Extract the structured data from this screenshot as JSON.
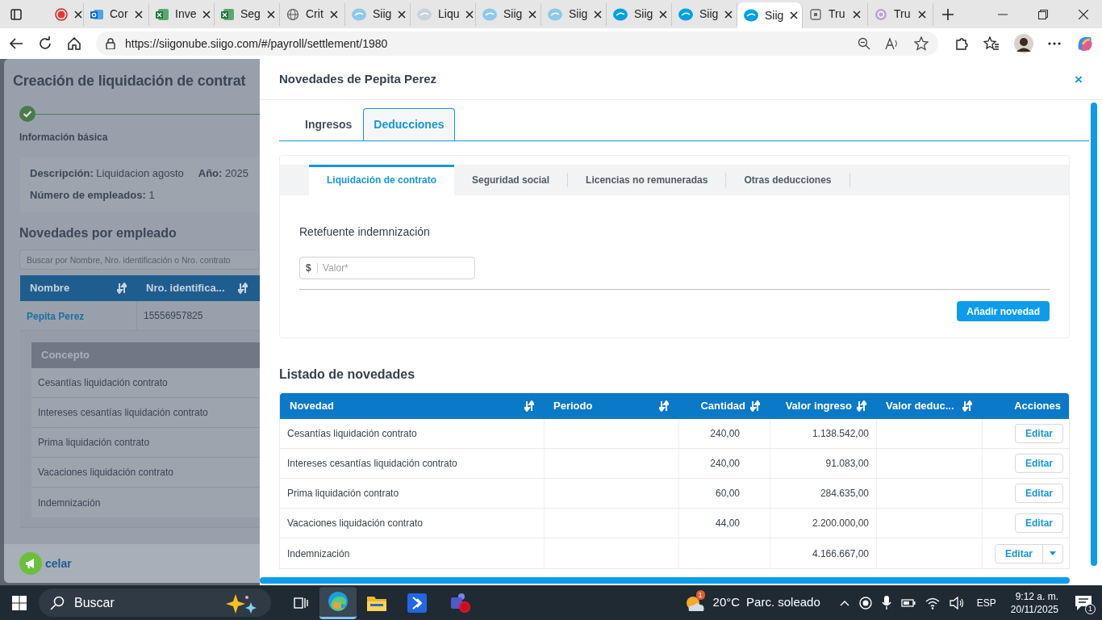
{
  "browser": {
    "tabs": [
      {
        "kind": "record",
        "selected": false
      },
      {
        "kind": "outlook",
        "label": "Cor",
        "selected": false
      },
      {
        "kind": "sheet",
        "label": "Inve",
        "selected": false
      },
      {
        "kind": "sheet",
        "label": "Seg",
        "selected": false
      },
      {
        "kind": "globe",
        "label": "Crit",
        "selected": false
      },
      {
        "kind": "siigo-light",
        "label": "Siig",
        "selected": false
      },
      {
        "kind": "siigo-pale",
        "label": "Liqu",
        "selected": false
      },
      {
        "kind": "siigo-light",
        "label": "Siig",
        "selected": false
      },
      {
        "kind": "siigo-light",
        "label": "Siig",
        "selected": false
      },
      {
        "kind": "siigo",
        "label": "Siig",
        "selected": false
      },
      {
        "kind": "siigo",
        "label": "Siig",
        "selected": false
      },
      {
        "kind": "siigo",
        "label": "Siig",
        "selected": true
      },
      {
        "kind": "page",
        "label": "Tru",
        "selected": false
      },
      {
        "kind": "ring",
        "label": "Tru",
        "selected": false
      }
    ],
    "url": "https://siigonube.siigo.com/#/payroll/settlement/1980"
  },
  "background_page": {
    "title": "Creación de liquidación de contrat",
    "step": "Información básica",
    "info": [
      "**Descripción:** Liquidacion agosto",
      "**Año:** 2025",
      "**Número de empleados:** 1"
    ],
    "section_title": "Novedades por empleado",
    "search": {
      "placeholder": "Buscar por Nombre, Nro. identificación o Nro. contrato"
    },
    "columns": [
      "Nombre",
      "Nro. identifica..."
    ],
    "employee": {
      "name": "Pepita Perez",
      "id": "15556957825"
    },
    "concept_header": "Concepto",
    "concepts": [
      "Cesantías liquidación contrato",
      "Intereses cesantías liquidación contrato",
      "Prima liquidación contrato",
      "Vacaciones liquidación contrato",
      "Indemnización"
    ],
    "cancel": "celar"
  },
  "drawer": {
    "title": "Novedades de Pepita Perez",
    "close": "×",
    "tabs": [
      {
        "label": "Ingresos",
        "selected": false
      },
      {
        "label": "Deducciones",
        "selected": true
      }
    ],
    "subtabs": [
      {
        "label": "Liquidación de contrato",
        "selected": true
      },
      {
        "label": "Seguridad social",
        "selected": false
      },
      {
        "label": "Licencias no remuneradas",
        "selected": false
      },
      {
        "label": "Otras deducciones",
        "selected": false
      }
    ],
    "field": {
      "label": "Retefuente indemnización",
      "prefix": "$",
      "placeholder": "Valor*"
    },
    "add_button": "Añadir novedad",
    "list_title": "Listado de novedades",
    "table": {
      "columns": [
        {
          "label": "Novedad",
          "sortable": true
        },
        {
          "label": "Periodo",
          "sortable": true
        },
        {
          "label": "Cantidad",
          "sortable": true
        },
        {
          "label": "Valor ingreso",
          "sortable": true
        },
        {
          "label": "Valor deduc...",
          "sortable": true
        },
        {
          "label": "Acciones",
          "sortable": false
        }
      ],
      "rows": [
        {
          "novedad": "Cesantías liquidación contrato",
          "cantidad": "240,00",
          "valor_ingreso": "1.138.542,00",
          "action": "Editar",
          "kind": "single"
        },
        {
          "novedad": "Intereses cesantías liquidación contrato",
          "cantidad": "240,00",
          "valor_ingreso": "91.083,00",
          "action": "Editar",
          "kind": "single"
        },
        {
          "novedad": "Prima liquidación contrato",
          "cantidad": "60,00",
          "valor_ingreso": "284.635,00",
          "action": "Editar",
          "kind": "single"
        },
        {
          "novedad": "Vacaciones liquidación contrato",
          "cantidad": "44,00",
          "valor_ingreso": "2.200.000,00",
          "action": "Editar",
          "kind": "single"
        },
        {
          "novedad": "Indemnización",
          "valor_ingreso": "4.166.667,00",
          "action": "Editar",
          "kind": "split"
        }
      ]
    }
  },
  "taskbar": {
    "search": "Buscar",
    "weather": {
      "temp": "20°C",
      "text": "Parc. soleado",
      "badge": "1"
    },
    "language": "ESP",
    "time": "9:12 a. m.",
    "date": "20/11/2025",
    "notifications": "1"
  }
}
